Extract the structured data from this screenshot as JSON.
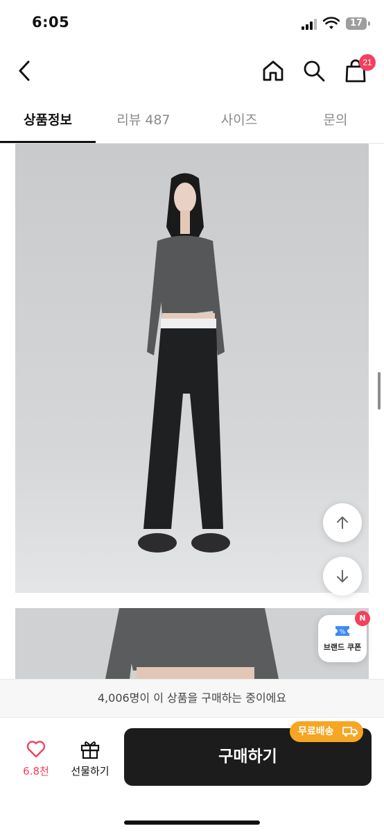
{
  "status_bar": {
    "time": "6:05",
    "battery": "17"
  },
  "top_nav": {
    "back_icon": "chevron-left-icon",
    "home_icon": "home-icon",
    "search_icon": "search-icon",
    "cart_icon": "shopping-bag-icon",
    "cart_badge": "21"
  },
  "tabs": [
    {
      "label": "상품정보",
      "active": true
    },
    {
      "label": "리뷰 487",
      "active": false
    },
    {
      "label": "사이즈",
      "active": false
    },
    {
      "label": "문의",
      "active": false
    }
  ],
  "floating": {
    "scroll_up_icon": "arrow-up-icon",
    "scroll_down_icon": "arrow-down-icon",
    "coupon_label": "브랜드 쿠폰",
    "coupon_badge": "N"
  },
  "notice": "4,006명이 이 상품을 구매하는 중이에요",
  "bottom_bar": {
    "like_count": "6.8천",
    "gift_label": "선물하기",
    "buy_label": "구매하기",
    "shipping_badge": "무료배송"
  },
  "colors": {
    "accent": "#f4405c",
    "buy_button": "#1c1c1c",
    "shipping_badge": "#f6a623"
  }
}
